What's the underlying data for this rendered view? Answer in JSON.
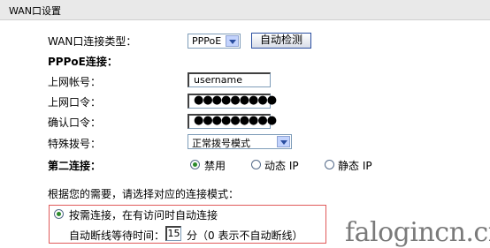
{
  "header": {
    "title": "WAN口设置"
  },
  "form": {
    "wan_type_label": "WAN口连接类型：",
    "wan_type_value": "PPPoE",
    "auto_detect_label": "自动检测",
    "pppoe_section": "PPPoE连接：",
    "username_label": "上网帐号：",
    "username_value": "username",
    "password_label": "上网口令：",
    "password_value": "●●●●●●●●●",
    "confirm_label": "确认口令：",
    "confirm_value": "●●●●●●●●●",
    "dial_label": "特殊拨号：",
    "dial_value": "正常拨号模式",
    "second_conn_label": "第二连接：",
    "second_conn_options": [
      {
        "label": "禁用",
        "selected": true
      },
      {
        "label": "动态 IP",
        "selected": false
      },
      {
        "label": "静态 IP",
        "selected": false
      }
    ],
    "mode_prompt": "根据您的需要，请选择对应的连接模式：",
    "mode_option_label": "按需连接，在有访问时自动连接",
    "mode_option_selected": true,
    "idle_label": "自动断线等待时间：",
    "idle_value": "15",
    "idle_suffix": "分（0 表示不自动断线）"
  },
  "watermark": {
    "text": "falogincn.cn"
  },
  "colors": {
    "header_bg": "#e9e9e9",
    "highlight_border": "#e05a5a",
    "radio_dot": "#2b8a2b"
  }
}
